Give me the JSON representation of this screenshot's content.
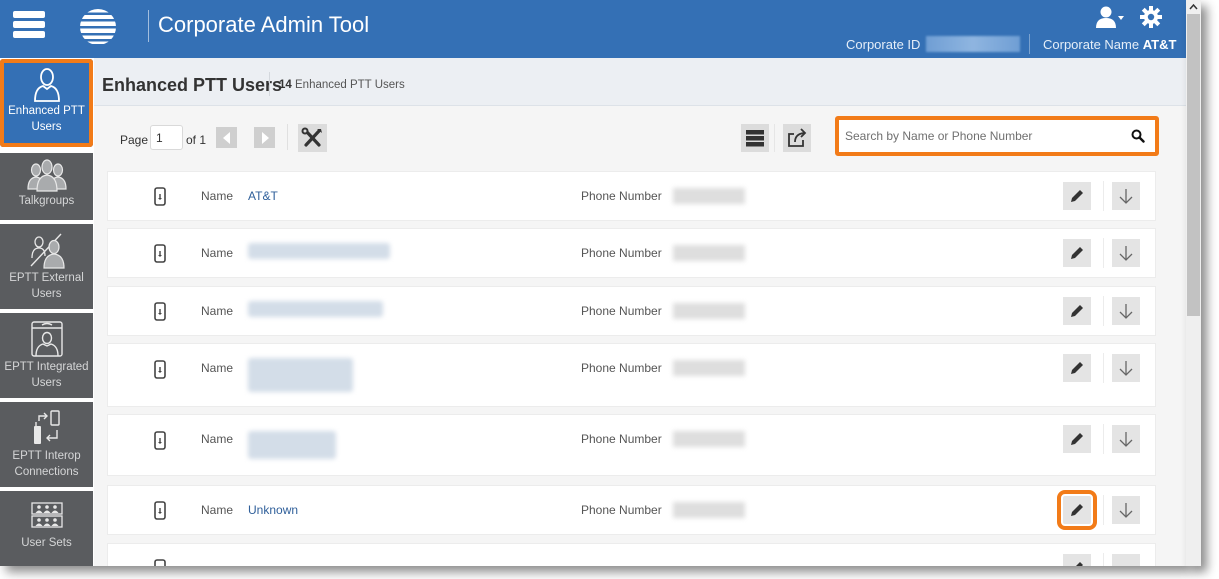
{
  "header": {
    "app_title": "Corporate Admin Tool",
    "corporate_id_label": "Corporate ID",
    "corporate_id_value": "",
    "corporate_name_label": "Corporate Name",
    "corporate_name_value": "AT&T",
    "brand_color": "#3470b5",
    "highlight_color": "#f27b18"
  },
  "sidebar": {
    "items": [
      {
        "label": "Enhanced PTT Users",
        "icon": "user-icon",
        "active": true
      },
      {
        "label": "Talkgroups",
        "icon": "group-icon",
        "active": false
      },
      {
        "label": "EPTT External Users",
        "icon": "external-user-icon",
        "active": false
      },
      {
        "label": "EPTT Integrated Users",
        "icon": "integrated-user-icon",
        "active": false
      },
      {
        "label": "EPTT Interop Connections",
        "icon": "interop-icon",
        "active": false
      },
      {
        "label": "User Sets",
        "icon": "user-sets-icon",
        "active": false
      }
    ]
  },
  "page": {
    "title": "Enhanced PTT Users",
    "count": "14",
    "count_label": "Enhanced PTT Users"
  },
  "toolbar": {
    "page_label": "Page",
    "page_value": "1",
    "of_label": "of 1",
    "search_placeholder": "Search by Name or Phone Number"
  },
  "rows": [
    {
      "name_label": "Name",
      "name": "AT&T",
      "phone_label": "Phone Number",
      "phone": "",
      "name_redacted": false
    },
    {
      "name_label": "Name",
      "name": "",
      "phone_label": "Phone Number",
      "phone": "",
      "name_redacted": true
    },
    {
      "name_label": "Name",
      "name": "",
      "phone_label": "Phone Number",
      "phone": "",
      "name_redacted": true
    },
    {
      "name_label": "Name",
      "name": "",
      "phone_label": "Phone Number",
      "phone": "",
      "name_redacted": true
    },
    {
      "name_label": "Name",
      "name": "",
      "phone_label": "Phone Number",
      "phone": "",
      "name_redacted": true
    },
    {
      "name_label": "Name",
      "name": "Unknown",
      "phone_label": "Phone Number",
      "phone": "",
      "name_redacted": false,
      "edit_highlighted": true
    }
  ]
}
